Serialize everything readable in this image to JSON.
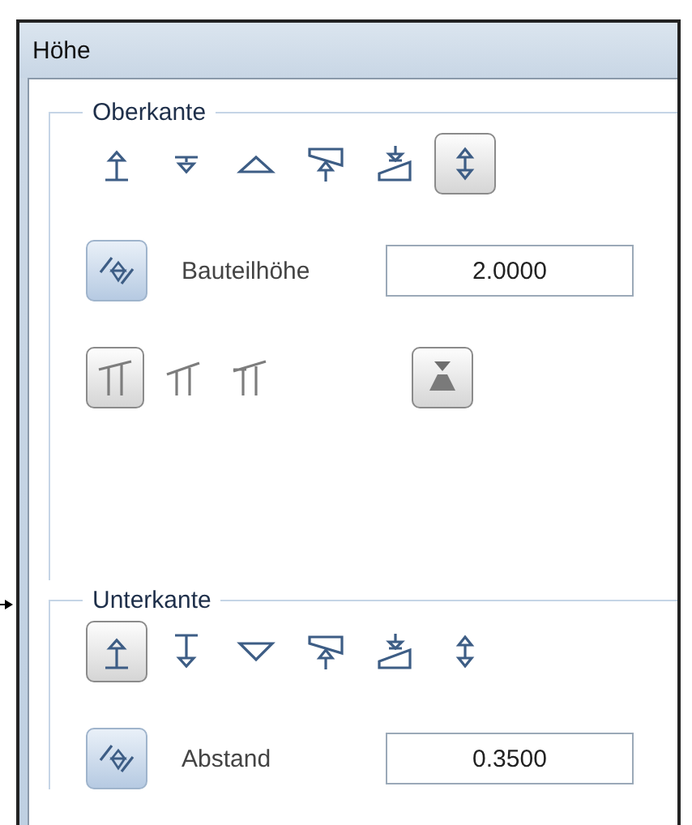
{
  "window": {
    "title": "Höhe"
  },
  "groups": [
    {
      "legend": "Oberkante",
      "modes": [
        {
          "kind": "base-arrow-up",
          "selected": false
        },
        {
          "kind": "line-arrow-down",
          "selected": false
        },
        {
          "kind": "triangle-up",
          "selected": false
        },
        {
          "kind": "wedge-arrow-up",
          "selected": false
        },
        {
          "kind": "ramp-arrow-down",
          "selected": false
        },
        {
          "kind": "double-arrow",
          "selected": true
        }
      ],
      "field": {
        "label": "Bauteilhöhe",
        "value": "2.0000",
        "linked": true
      },
      "options": [
        {
          "kind": "roof-two-posts",
          "selected": true
        },
        {
          "kind": "roof-left",
          "selected": false
        },
        {
          "kind": "roof-right",
          "selected": false
        },
        {
          "kind": "hourglass",
          "selected": true
        }
      ]
    },
    {
      "legend": "Unterkante",
      "modes": [
        {
          "kind": "base-arrow-up",
          "selected": true
        },
        {
          "kind": "tall-line-arrow-down",
          "selected": false
        },
        {
          "kind": "triangle-down",
          "selected": false
        },
        {
          "kind": "wedge-arrow-up",
          "selected": false
        },
        {
          "kind": "ramp-arrow-down",
          "selected": false
        },
        {
          "kind": "double-arrow",
          "selected": false
        }
      ],
      "field": {
        "label": "Abstand",
        "value": "0.3500",
        "linked": true
      }
    }
  ]
}
